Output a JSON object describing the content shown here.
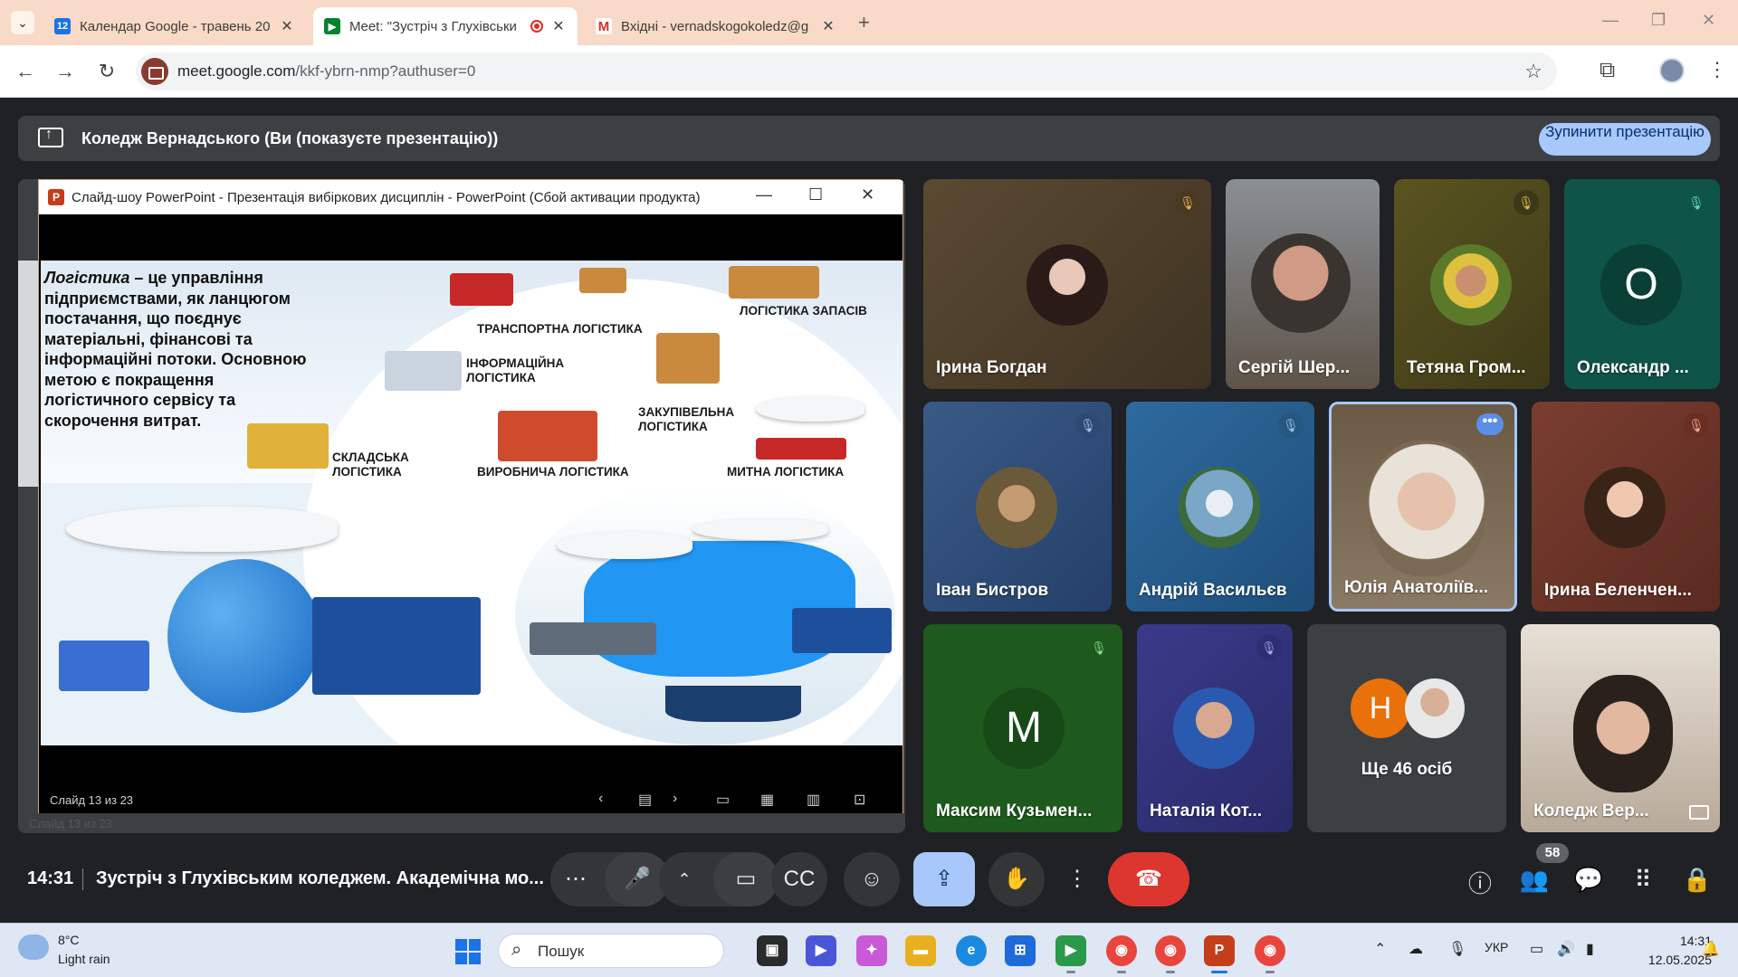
{
  "browser": {
    "tabs": [
      {
        "title": "Календар Google - травень 20",
        "favicon": "calendar-icon",
        "active": false
      },
      {
        "title": "Meet: \"Зустріч з Глухівськи",
        "favicon": "meet-icon",
        "active": true,
        "recording": true
      },
      {
        "title": "Вхідні - vernadskogokoledz@g",
        "favicon": "gmail-icon",
        "active": false
      }
    ],
    "url": "meet.google.com",
    "url_path": "/kkf-ybrn-nmp?authuser=0"
  },
  "present_bar": {
    "text": "Коледж Вернадського (Ви (показуєте презентацію))",
    "stop_button": "Зупинити презентацію"
  },
  "powerpoint": {
    "window_title": "Слайд-шоу PowerPoint  -  Презентація вибіркових дисциплін - PowerPoint (Сбой активации продукта)",
    "slide_status": "Слайд 13 из 23",
    "slide": {
      "definition_term": "Логістика",
      "definition_rest": " – це управління підприємствами, як ланцюгом постачання, що поєднує матеріальні, фінансові та інформаційні потоки.  Основною метою є покращення логістичного сервісу та скорочення витрат.",
      "labels": {
        "transport": "ТРАНСПОРТНА ЛОГІСТИКА",
        "inventory": "ЛОГІСТИКА ЗАПАСІВ",
        "information": "ІНФОРМАЦІЙНА ЛОГІСТИКА",
        "procurement": "ЗАКУПІВЕЛЬНА ЛОГІСТИКА",
        "warehouse": "СКЛАДСЬКА ЛОГІСТИКА",
        "production": "ВИРОБНИЧА ЛОГІСТИКА",
        "customs": "МИТНА ЛОГІСТИКА"
      }
    }
  },
  "participants": [
    {
      "name": "Ірина Богдан",
      "muted": true
    },
    {
      "name": "Сергій Шер...",
      "muted": false
    },
    {
      "name": "Тетяна Гром...",
      "muted": true
    },
    {
      "name": "Олександр ...",
      "muted": true,
      "initial": "О"
    },
    {
      "name": "Іван Бистров",
      "muted": true
    },
    {
      "name": "Андрій Васильєв",
      "muted": true
    },
    {
      "name": "Юлія Анатоліїв...",
      "muted": false,
      "speaking": true
    },
    {
      "name": "Ірина Беленчен...",
      "muted": true
    },
    {
      "name": "Максим Кузьмен...",
      "muted": true,
      "initial": "М"
    },
    {
      "name": "Наталія Кот...",
      "muted": true
    },
    {
      "name": "Ще 46 осіб",
      "initial": "Н"
    },
    {
      "name": "Коледж Вер...",
      "self": true
    }
  ],
  "controls": {
    "time": "14:31",
    "meeting_title": "Зустріч з Глухівським коледжем. Академічна мо...",
    "people_count": "58"
  },
  "taskbar": {
    "weather_temp": "8°C",
    "weather_desc": "Light rain",
    "search_placeholder": "Пошук",
    "language": "УКР",
    "clock_time": "14:31",
    "clock_date": "12.05.2025"
  },
  "colors": {
    "tabbar": "#f9d9c7",
    "meet_bg": "#202124",
    "accent": "#a8c7fa",
    "hangup": "#dc362e"
  }
}
